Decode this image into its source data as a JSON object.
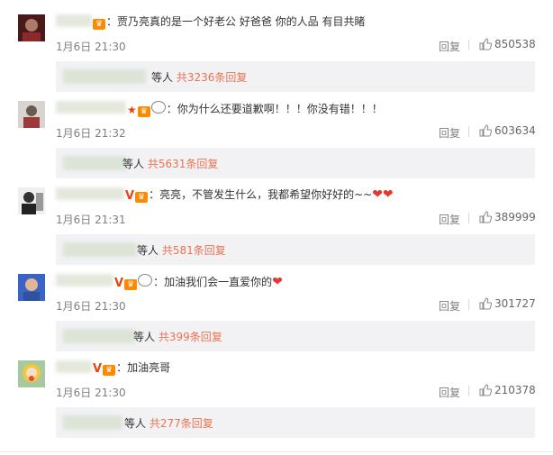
{
  "comments": [
    {
      "badges": [
        "vip"
      ],
      "text": "贾乃亮真的是一个好老公 好爸爸 你的人品 有目共睹",
      "time": "1月6日 21:30",
      "reply_label": "回复",
      "likes": "850538",
      "reply_summary": {
        "suffix": "等人",
        "count_text": "共3236条回复"
      }
    },
    {
      "badges": [
        "star",
        "vip",
        "panda"
      ],
      "text": "你为什么还要道歉啊！！！你没有错！！！",
      "time": "1月6日 21:32",
      "reply_label": "回复",
      "likes": "603634",
      "reply_summary": {
        "suffix": "等人",
        "count_text": "共5631条回复"
      }
    },
    {
      "badges": [
        "v",
        "vip"
      ],
      "text": "亮亮，不管发生什么，我都希望你好好的~~",
      "trailing": "❤❤",
      "time": "1月6日 21:31",
      "reply_label": "回复",
      "likes": "389999",
      "reply_summary": {
        "suffix": "等人",
        "count_text": "共581条回复"
      }
    },
    {
      "badges": [
        "v",
        "vip",
        "panda"
      ],
      "text": "加油我们会一直爱你的",
      "trailing": "❤",
      "time": "1月6日 21:30",
      "reply_label": "回复",
      "likes": "301727",
      "reply_summary": {
        "suffix": "等人",
        "count_text": "共399条回复"
      }
    },
    {
      "badges": [
        "v",
        "vip"
      ],
      "text": "加油亮哥",
      "time": "1月6日 21:30",
      "reply_label": "回复",
      "likes": "210378",
      "reply_summary": {
        "suffix": "等人",
        "count_text": "共277条回复"
      }
    }
  ],
  "colors": {
    "accent": "#eb7350",
    "muted": "#808080",
    "reply_bg": "#f2f2f5"
  },
  "icons": {
    "like": "thumbs-up-icon",
    "vip": "vip-crown-icon",
    "verified": "verified-v-icon",
    "heart": "heart-emoji"
  }
}
